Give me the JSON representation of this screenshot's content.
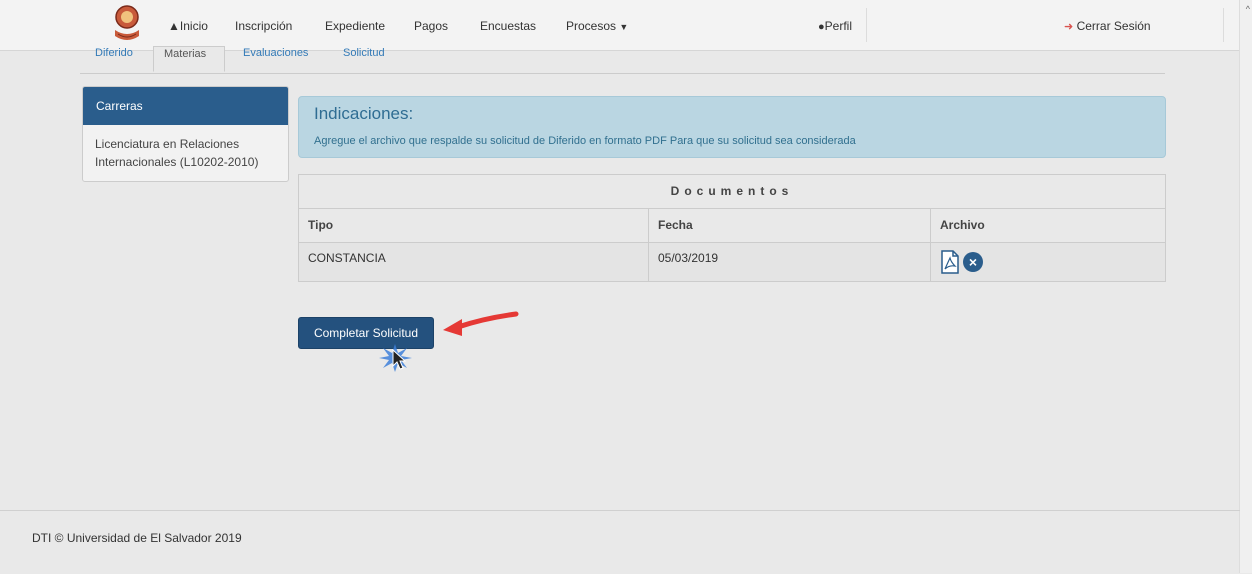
{
  "nav": {
    "logo": "university-seal",
    "items": [
      "Inicio",
      "Inscripción",
      "Expediente",
      "Pagos",
      "Encuestas",
      "Procesos"
    ],
    "profile": "Perfil",
    "logout": "Cerrar Sesión"
  },
  "tabs": [
    "Diferido",
    "Materias",
    "Evaluaciones",
    "Solicitud"
  ],
  "sidebar": {
    "header": "Carreras",
    "item": "Licenciatura en Relaciones Internacionales (L10202-2010)"
  },
  "info": {
    "title": "Indicaciones:",
    "text": "Agregue el archivo que respalde su solicitud de Diferido en formato PDF Para que su solicitud sea considerada"
  },
  "documents": {
    "title": "Documentos",
    "columns": [
      "Tipo",
      "Fecha",
      "Archivo"
    ],
    "rows": [
      {
        "tipo": "CONSTANCIA",
        "fecha": "05/03/2019",
        "archivo_icons": [
          "pdf-icon",
          "remove-icon"
        ]
      }
    ]
  },
  "button": {
    "label": "Completar Solicitud"
  },
  "footer": {
    "text": "DTI © Universidad de El Salvador 2019"
  },
  "colors": {
    "primary": "#24517e",
    "info_bg": "#bad6e2",
    "logout_icon": "#d9534f",
    "arrow": "#e53935"
  }
}
